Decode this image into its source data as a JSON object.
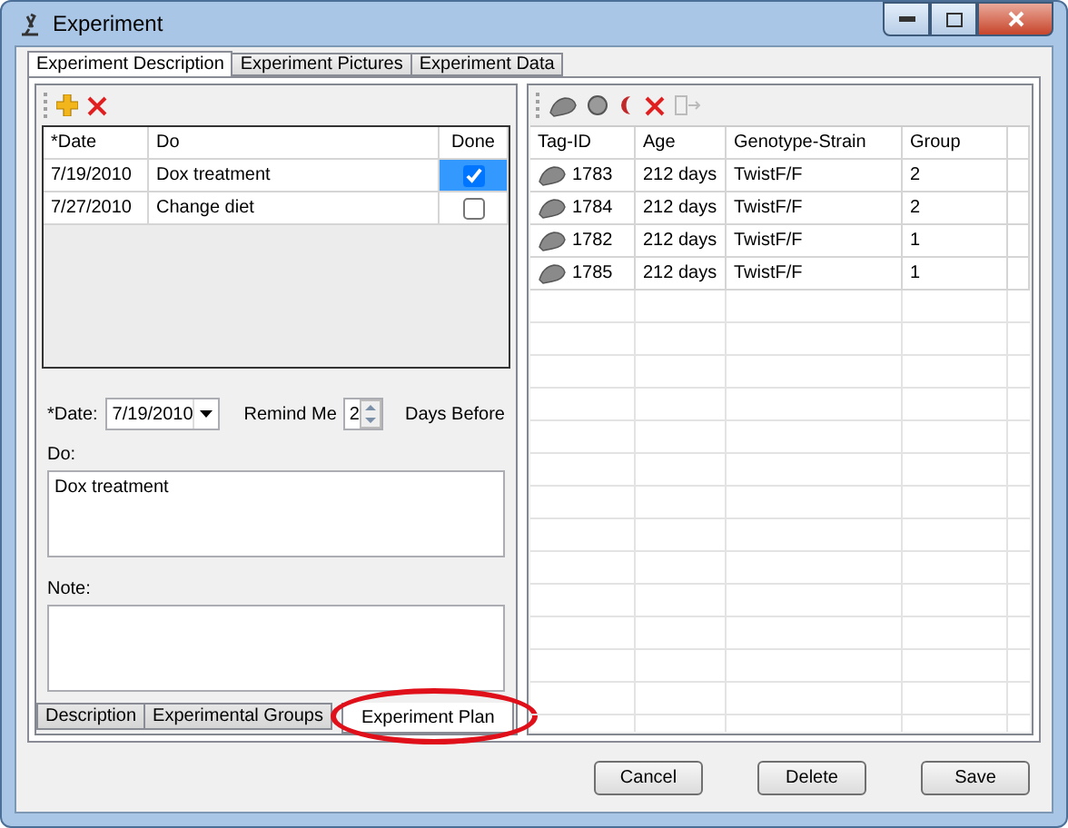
{
  "window": {
    "title": "Experiment"
  },
  "tabs": [
    {
      "label": "Experiment Description",
      "selected": true
    },
    {
      "label": "Experiment Pictures",
      "selected": false
    },
    {
      "label": "Experiment Data",
      "selected": false
    }
  ],
  "plan_table": {
    "columns": [
      "*Date",
      "Do",
      "Done"
    ],
    "rows": [
      {
        "date": "7/19/2010",
        "do": "Dox treatment",
        "done": true,
        "selected": true
      },
      {
        "date": "7/27/2010",
        "do": "Change diet",
        "done": false,
        "selected": false
      }
    ]
  },
  "form": {
    "date_label": "*Date:",
    "date_value": "7/19/2010",
    "remind_label": "Remind Me",
    "remind_value": "2",
    "remind_suffix": "Days Before",
    "do_label": "Do:",
    "do_value": "Dox treatment",
    "note_label": "Note:"
  },
  "bottom_tabs": [
    {
      "label": "Description",
      "selected": false
    },
    {
      "label": "Experimental Groups",
      "selected": false
    },
    {
      "label": "Experiment Plan",
      "selected": true
    }
  ],
  "mice_table": {
    "columns": [
      "Tag-ID",
      "Age",
      "Genotype-Strain",
      "Group"
    ],
    "rows": [
      {
        "tag": "1783",
        "age": "212 days",
        "strain": "TwistF/F",
        "group": "2"
      },
      {
        "tag": "1784",
        "age": "212 days",
        "strain": "TwistF/F",
        "group": "2"
      },
      {
        "tag": "1782",
        "age": "212 days",
        "strain": "TwistF/F",
        "group": "1"
      },
      {
        "tag": "1785",
        "age": "212 days",
        "strain": "TwistF/F",
        "group": "1"
      }
    ]
  },
  "buttons": [
    "Cancel",
    "Delete",
    "Save"
  ]
}
